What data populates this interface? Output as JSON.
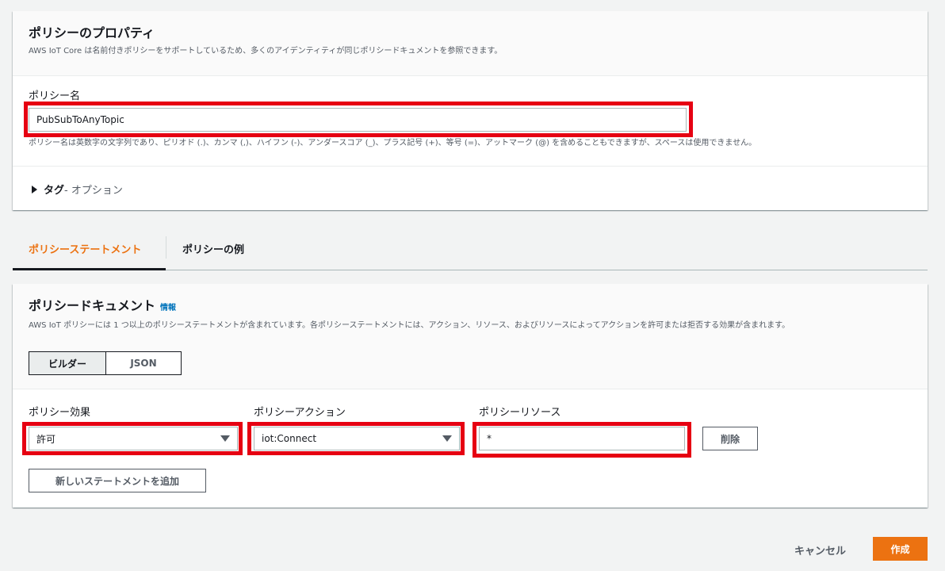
{
  "properties": {
    "title": "ポリシーのプロパティ",
    "description": "AWS IoT Core は名前付きポリシーをサポートしているため、多くのアイデンティティが同じポリシードキュメントを参照できます。",
    "name_label": "ポリシー名",
    "name_value": "PubSubToAnyTopic",
    "name_hint": "ポリシー名は英数字の文字列であり、ピリオド (.)、カンマ (,)、ハイフン (-)、アンダースコア (_)、プラス記号 (+)、等号 (=)、アットマーク (@) を含めることもできますが、スペースは使用できません。",
    "tags_label": "タグ",
    "tags_optional": " - オプション"
  },
  "tabs": [
    {
      "label": "ポリシーステートメント",
      "active": true
    },
    {
      "label": "ポリシーの例",
      "active": false
    }
  ],
  "document": {
    "title": "ポリシードキュメント",
    "info_link": "情報",
    "description": "AWS IoT ポリシーには 1 つ以上のポリシーステートメントが含まれています。各ポリシーステートメントには、アクション、リソース、およびリソースによってアクションを許可または拒否する効果が含まれます。",
    "mode_builder": "ビルダー",
    "mode_json": "JSON",
    "effect_label": "ポリシー効果",
    "effect_value": "許可",
    "action_label": "ポリシーアクション",
    "action_value": "iot:Connect",
    "resource_label": "ポリシーリソース",
    "resource_value": "*",
    "delete_label": "削除",
    "add_statement_label": "新しいステートメントを追加"
  },
  "footer": {
    "cancel_label": "キャンセル",
    "create_label": "作成"
  },
  "colors": {
    "accent": "#ec7211",
    "highlight": "#e60012",
    "link": "#0073bb"
  }
}
